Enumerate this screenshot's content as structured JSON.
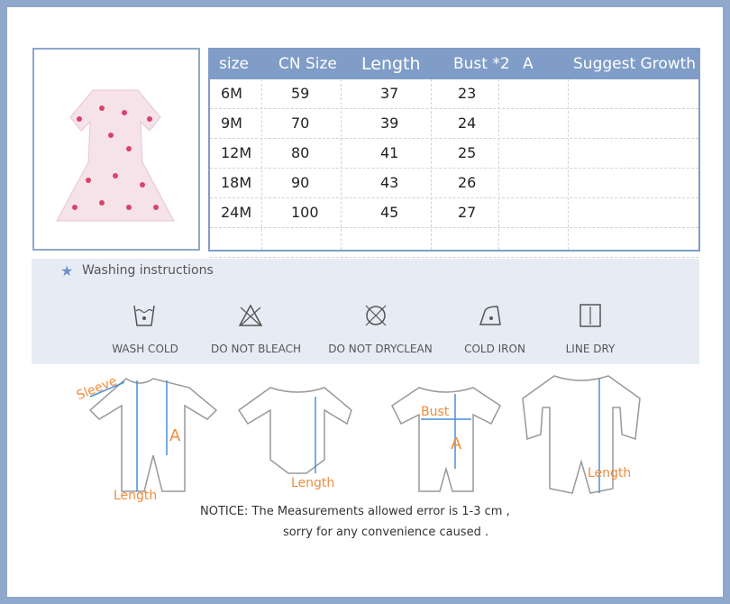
{
  "table": {
    "headers": [
      "size",
      "CN Size",
      "Length",
      "Bust *2",
      "A",
      "Suggest Growth"
    ],
    "rows": [
      [
        "6M",
        "59",
        "37",
        "23"
      ],
      [
        "9M",
        "70",
        "39",
        "24"
      ],
      [
        "12M",
        "80",
        "41",
        "25"
      ],
      [
        "18M",
        "90",
        "43",
        "26"
      ],
      [
        "24M",
        "100",
        "45",
        "27"
      ]
    ]
  },
  "washing": {
    "title": "Washing instructions",
    "items": [
      "WASH COLD",
      "DO NOT BLEACH",
      "DO NOT DRYCLEAN",
      "COLD IRON",
      "LINE DRY"
    ]
  },
  "diagram": {
    "sleeve": "Sleeve",
    "a": "A",
    "length": "Length",
    "bust": "Bust"
  },
  "notice": {
    "line1": "NOTICE:   The Measurements allowed error is 1-3 cm ,",
    "line2": "sorry for any convenience caused ."
  },
  "colors": {
    "frame": "#8fa8cc",
    "header": "#7f9dc6",
    "measure": "#f08c3c",
    "line": "#4a8fd8"
  }
}
